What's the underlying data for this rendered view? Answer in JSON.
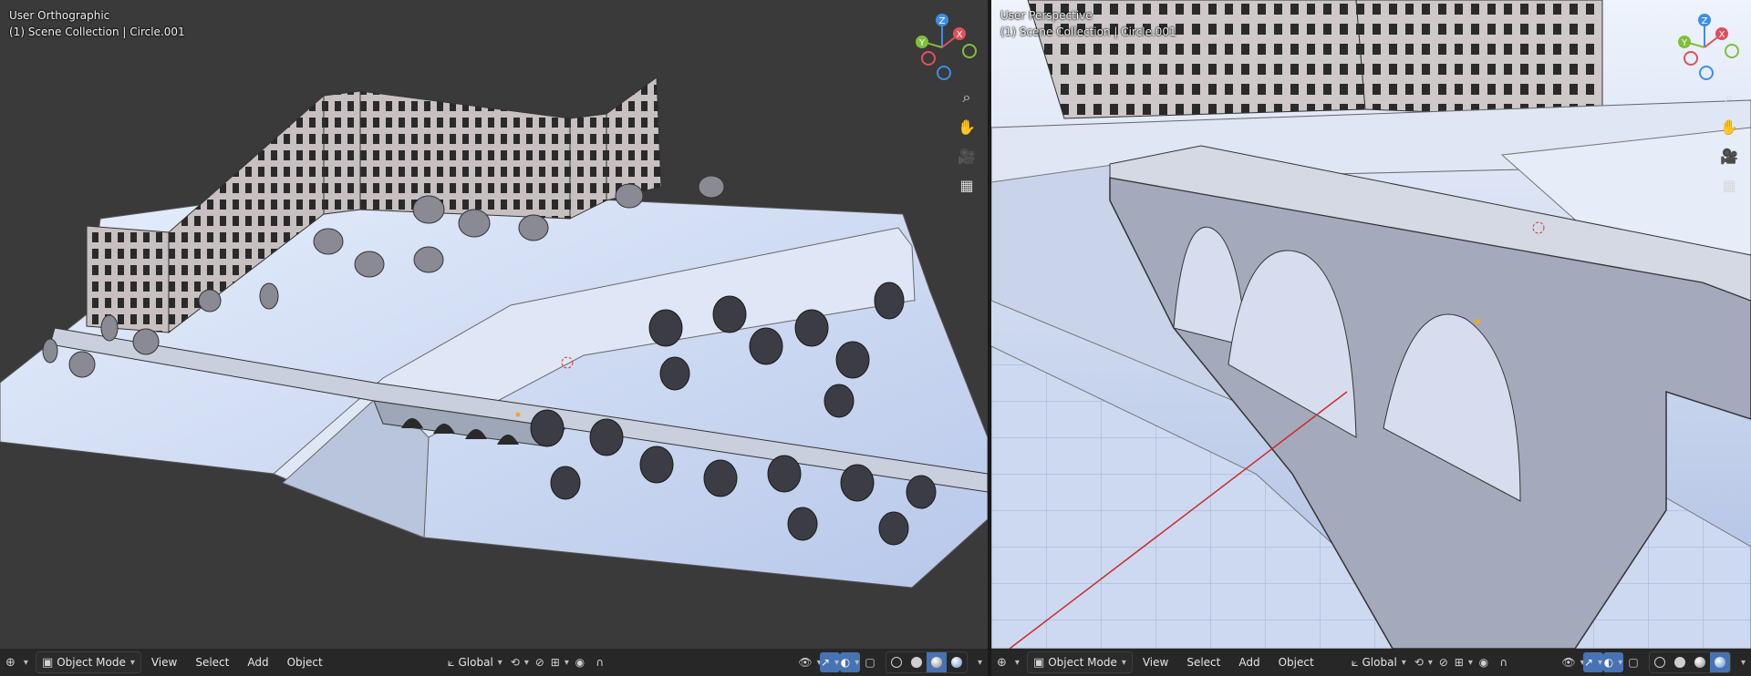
{
  "left_viewport": {
    "view_name": "User Orthographic",
    "collection_info": "(1) Scene Collection | Circle.001",
    "header": {
      "mode_label": "Object Mode",
      "menus": [
        "View",
        "Select",
        "Add",
        "Object"
      ],
      "transform_orientation": "Global"
    }
  },
  "right_viewport": {
    "view_name": "User Perspective",
    "collection_info": "(1) Scene Collection | Circle.001",
    "header": {
      "mode_label": "Object Mode",
      "menus": [
        "View",
        "Select",
        "Add",
        "Object"
      ],
      "transform_orientation": "Global"
    }
  },
  "gizmo": {
    "axes": {
      "x": "X",
      "y": "Y",
      "z": "Z"
    },
    "colors": {
      "x": "#e0505a",
      "y": "#7fbf3a",
      "z": "#3d8ee6",
      "neg_x": "#9a3a40",
      "neg_y": "#5c8a2b",
      "neg_z": "#2d63a3"
    }
  },
  "nav_icons": [
    "zoom-icon",
    "hand-pan-icon",
    "camera-icon",
    "grid-icon"
  ],
  "colors": {
    "viewport_bg": "#3a3a3a",
    "header_bg": "#262626",
    "accent": "#4772b3",
    "ground": "#c9d6ef",
    "building": "#b8b0b0"
  }
}
